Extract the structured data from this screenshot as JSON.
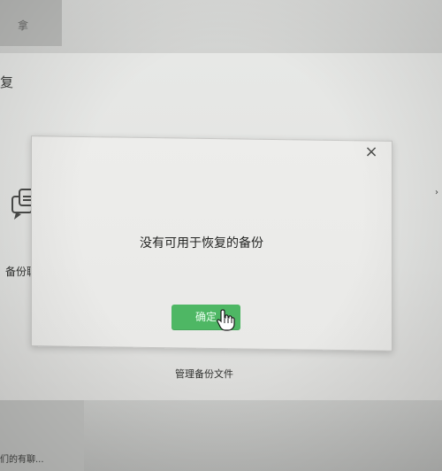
{
  "background": {
    "top_icon": "拿",
    "main_title": "复",
    "backup_label": "备份聊",
    "manage_link": "管理备份文件",
    "bottom_left_text": "们的有聊..."
  },
  "dialog": {
    "close_symbol": "×",
    "message": "没有可用于恢复的备份",
    "confirm_label": "确定"
  },
  "colors": {
    "confirm_button": "#4eb764",
    "dialog_bg": "#ededeb"
  }
}
